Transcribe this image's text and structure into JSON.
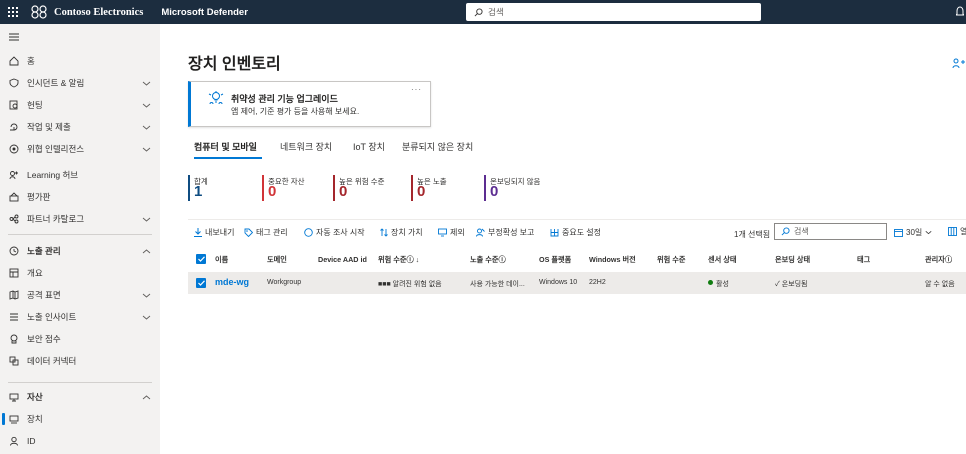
{
  "topbar": {
    "brand": "Contoso Electronics",
    "product": "Microsoft Defender",
    "search_placeholder": "검색"
  },
  "sidebar": {
    "items": [
      {
        "label": "홈",
        "icon": "home-icon"
      },
      {
        "label": "인시던트 & 알림",
        "icon": "shield-alert-icon"
      },
      {
        "label": "헌팅",
        "icon": "hunting-icon"
      },
      {
        "label": "작업 및 제출",
        "icon": "actions-icon"
      },
      {
        "label": "위협 인텔리전스",
        "icon": "threat-intel-icon"
      },
      {
        "label": "Learning 허브",
        "icon": "learning-icon"
      },
      {
        "label": "평가판",
        "icon": "trial-icon"
      },
      {
        "label": "파트너 카탈로그",
        "icon": "partner-icon"
      },
      {
        "label": "노출 관리",
        "icon": "exposure-icon"
      },
      {
        "label": "개요",
        "icon": "overview-icon"
      },
      {
        "label": "공격 표면",
        "icon": "attack-surface-icon"
      },
      {
        "label": "노출 인사이트",
        "icon": "insights-icon"
      },
      {
        "label": "보안 점수",
        "icon": "score-icon"
      },
      {
        "label": "데이터 커넥터",
        "icon": "connector-icon"
      },
      {
        "label": "자산",
        "icon": "assets-icon"
      },
      {
        "label": "장치",
        "icon": "device-icon"
      },
      {
        "label": "ID",
        "icon": "identity-icon"
      }
    ]
  },
  "main": {
    "title": "장치 인벤토리",
    "card": {
      "title": "취약성 관리 기능 업그레이드",
      "desc": "앱 제어, 기준 평가 등을 사용해 보세요.",
      "more": "···"
    },
    "tabs": [
      "컴퓨터 및 모바일",
      "네트워크 장치",
      "IoT 장치",
      "분류되지 않은 장치"
    ],
    "stats": [
      {
        "label": "합계",
        "value": "1",
        "color": "#0f4c81"
      },
      {
        "label": "중요한 자산",
        "value": "0",
        "color": "#d13438"
      },
      {
        "label": "높은 위험 수준",
        "value": "0",
        "color": "#a4262c"
      },
      {
        "label": "높은 노출",
        "value": "0",
        "color": "#a4262c"
      },
      {
        "label": "온보딩되지 않음",
        "value": "0",
        "color": "#5c2d91"
      }
    ],
    "toolbar": [
      "내보내기",
      "태그 관리",
      "자동 조사 시작",
      "장치 가치",
      "제외",
      "부정확성 보고",
      "중요도 설정"
    ],
    "selected": "1개 선택됨",
    "search_placeholder": "검색",
    "period": "30일",
    "period2": "열",
    "columns": [
      "이름",
      "도메인",
      "Device AAD id",
      "위험 수준ⓘ ↓",
      "노출 수준ⓘ",
      "OS 플랫폼",
      "Windows 버전",
      "위험 수준",
      "센서 상태",
      "온보딩 상태",
      "태그",
      "관리자ⓘ"
    ],
    "row": {
      "name": "mde-wg",
      "domain": "Workgroup",
      "aad": "",
      "risk": "■■■ 알려진 위험 없음",
      "exposure": "사용 가능한 데이...",
      "os": "Windows 10",
      "version": "22H2",
      "risk2": "",
      "sensor": "활성",
      "onboarding": "✓ 온보딩됨",
      "tags": "",
      "managed": "알 수 없음"
    }
  }
}
